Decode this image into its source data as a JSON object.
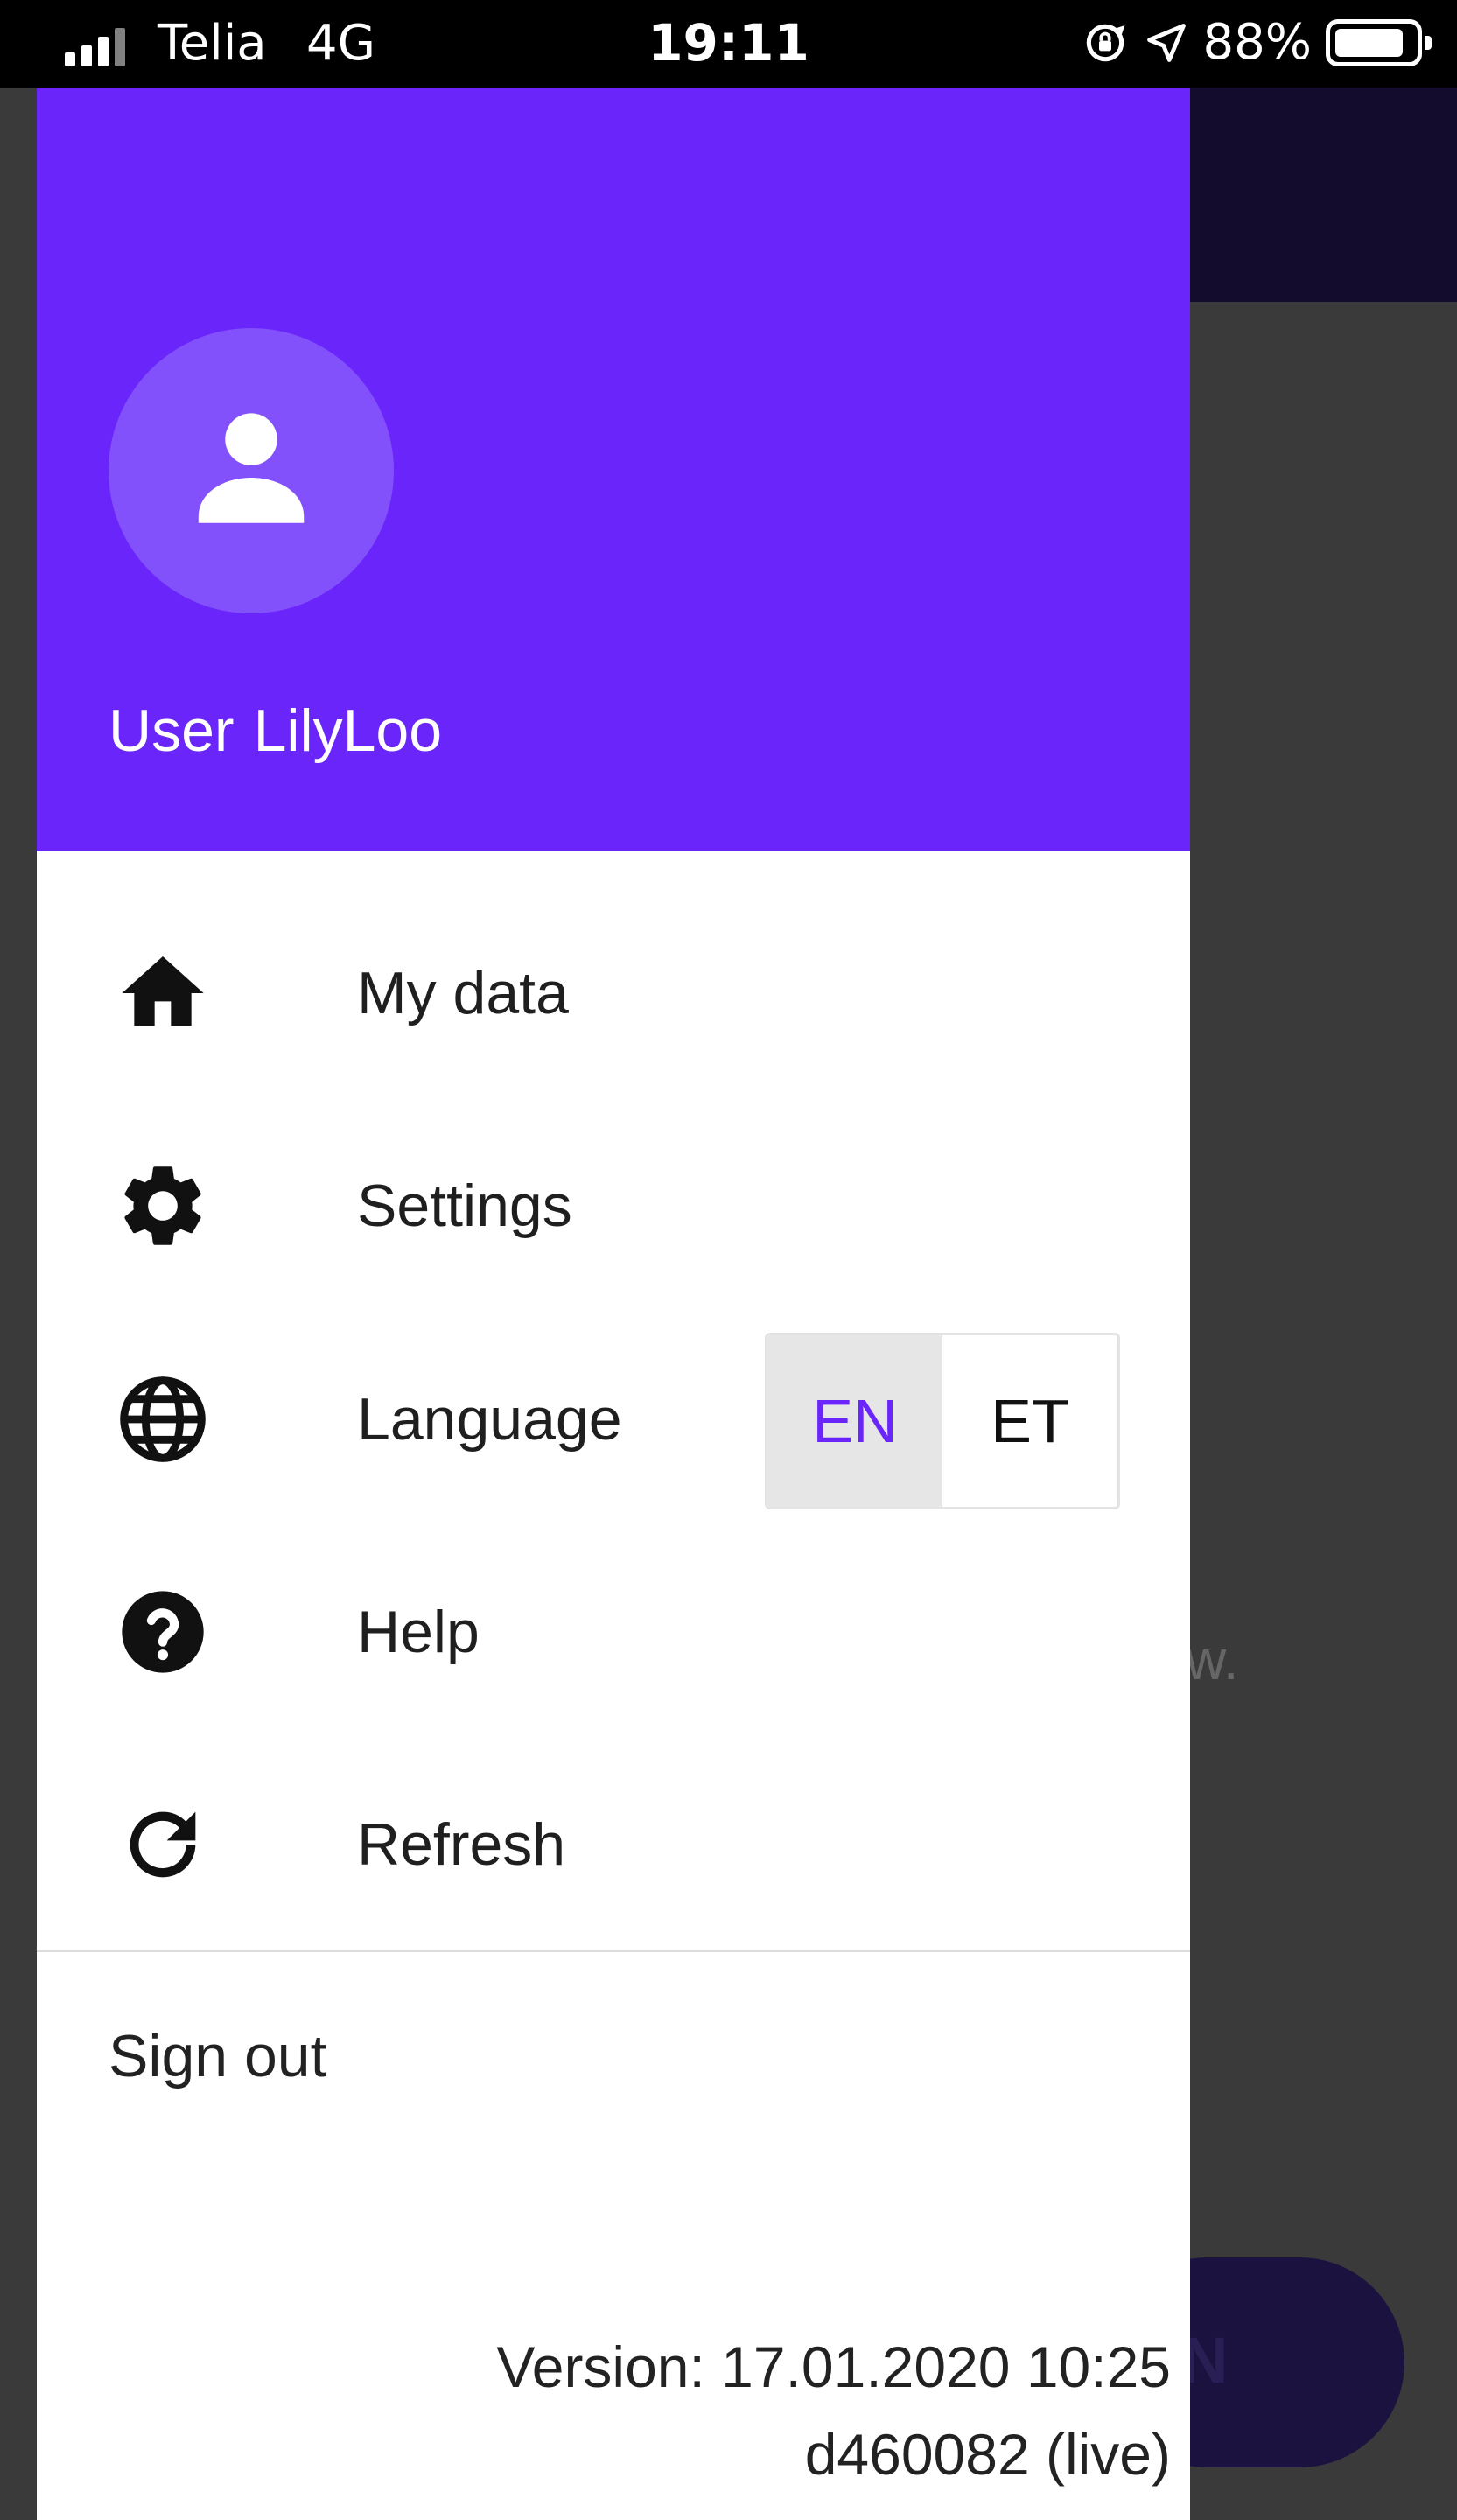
{
  "status_bar": {
    "carrier": "Telia",
    "network": "4G",
    "time": "19:11",
    "battery_percent": "88%",
    "battery_level": 0.88,
    "icons": [
      "signal-icon",
      "rotation-lock-icon",
      "location-icon",
      "battery-icon"
    ]
  },
  "drawer": {
    "header": {
      "avatar_icon": "person-icon",
      "user_label": "User",
      "user_name": "LilyLoo",
      "background_color": "#6a25fa"
    },
    "menu": [
      {
        "label": "My data",
        "icon": "home-icon"
      },
      {
        "label": "Settings",
        "icon": "gear-icon"
      },
      {
        "label": "Language",
        "icon": "globe-icon"
      },
      {
        "label": "Help",
        "icon": "help-icon"
      },
      {
        "label": "Refresh",
        "icon": "refresh-icon"
      }
    ],
    "language_toggle": {
      "options": [
        "EN",
        "ET"
      ],
      "selected": "EN",
      "accent_color": "#6a25fa"
    },
    "sign_out": "Sign out",
    "version_line1": "Version: 17.01.2020 10:25",
    "version_line2": "d460082 (live)"
  },
  "background_app": {
    "snippet_text": "w.",
    "button_text_fragment": "N"
  }
}
